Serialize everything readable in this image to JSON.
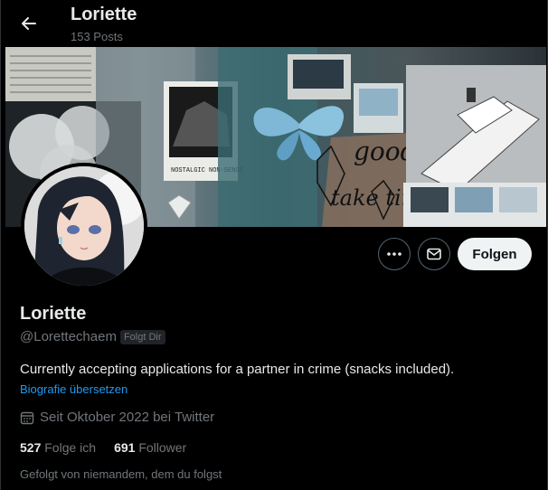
{
  "header": {
    "name": "Loriette",
    "posts_count": "153 Posts"
  },
  "banner": {
    "photo_caption": "NOSTALGIC NON-SENSE",
    "handwriting_1": "good th",
    "handwriting_2": "take time"
  },
  "actions": {
    "follow_label": "Folgen"
  },
  "profile": {
    "name": "Loriette",
    "handle": "@Lorettechaem",
    "follows_you_badge": "Folgt Dir",
    "bio": "Currently accepting applications for a partner in crime (snacks included).",
    "translate_link": "Biografie übersetzen",
    "joined": "Seit Oktober 2022 bei Twitter",
    "following_count": "527",
    "following_label": "Folge ich",
    "followers_count": "691",
    "followers_label": "Follower",
    "followed_by": "Gefolgt von niemandem, dem du folgst"
  },
  "colors": {
    "background": "#000000",
    "text_primary": "#e7e9ea",
    "text_secondary": "#71767b",
    "link": "#1d9bf0",
    "follow_button_bg": "#eff3f4"
  }
}
